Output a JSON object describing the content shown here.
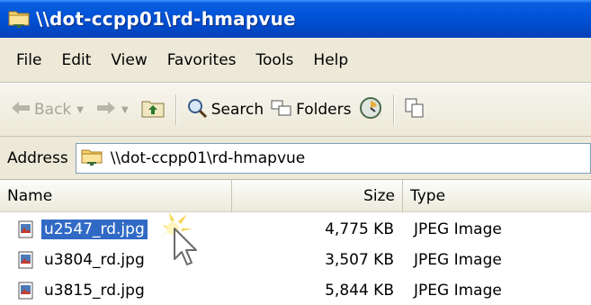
{
  "window": {
    "title": "\\\\dot-ccpp01\\rd-hmapvue"
  },
  "menu": {
    "items": [
      "File",
      "Edit",
      "View",
      "Favorites",
      "Tools",
      "Help"
    ]
  },
  "toolbar": {
    "back_label": "Back",
    "search_label": "Search",
    "folders_label": "Folders"
  },
  "address": {
    "label": "Address",
    "value": "\\\\dot-ccpp01\\rd-hmapvue"
  },
  "list": {
    "columns": {
      "name": "Name",
      "size": "Size",
      "type": "Type"
    },
    "rows": [
      {
        "name": "u2547_rd.jpg",
        "size": "4,775 KB",
        "type": "JPEG Image",
        "selected": true
      },
      {
        "name": "u3804_rd.jpg",
        "size": "3,507 KB",
        "type": "JPEG Image",
        "selected": false
      },
      {
        "name": "u3815_rd.jpg",
        "size": "5,844 KB",
        "type": "JPEG Image",
        "selected": false
      }
    ]
  },
  "colors": {
    "titlebar": "#0052d6",
    "selection": "#316ac5",
    "chrome": "#ece9d8"
  }
}
